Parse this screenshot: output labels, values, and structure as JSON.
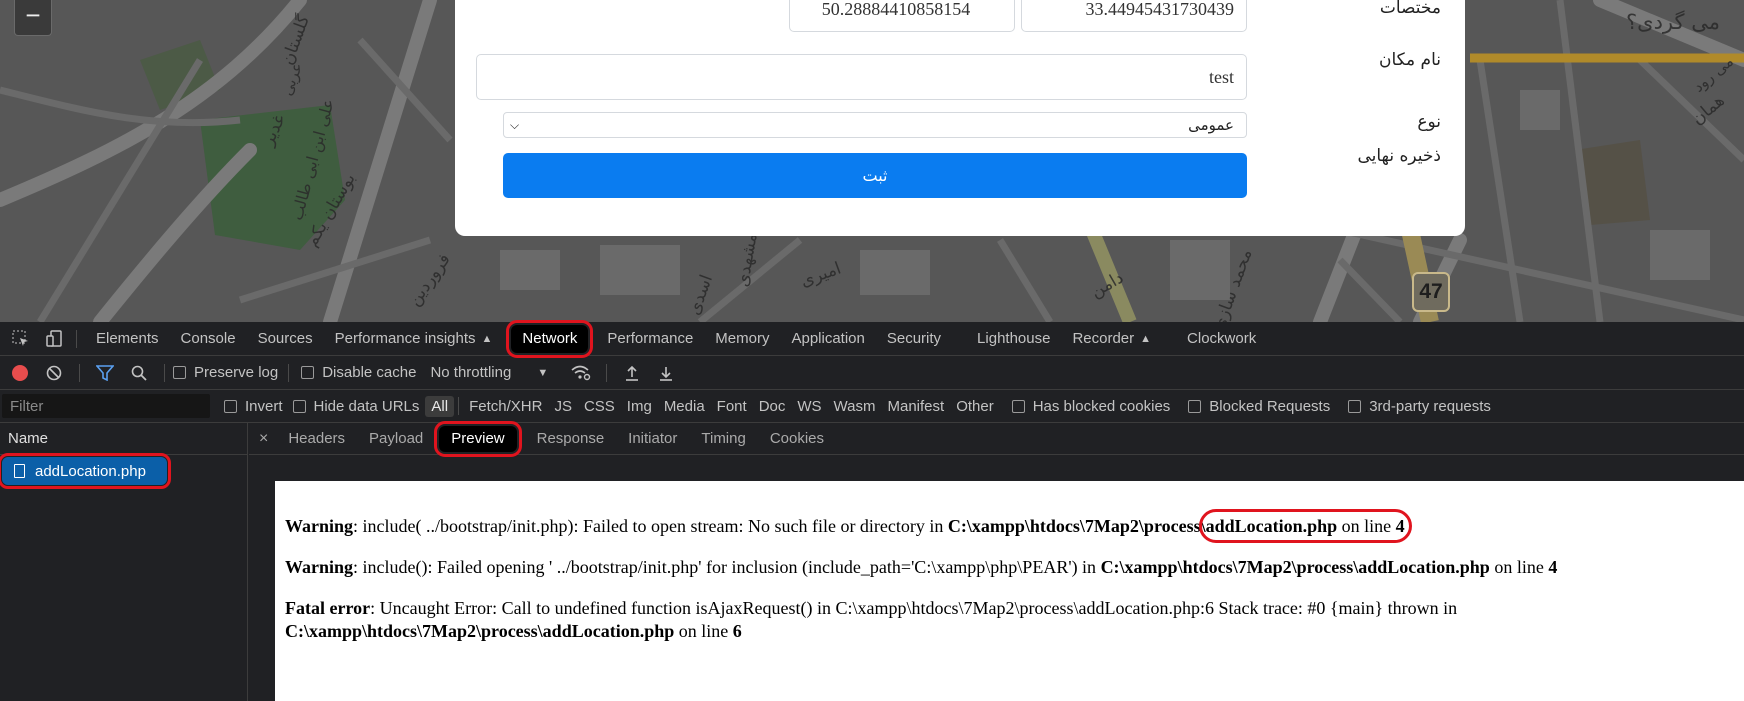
{
  "map": {
    "labels": [
      "می گردی؟",
      "بوستان یکم",
      "علی ابن ابی طالب",
      "غدیر",
      "فروردین",
      "امیری",
      "مشهدی",
      "اسدی",
      "محمد سازی",
      "گلستان",
      "عربی",
      "دامن",
      "همان",
      "می رود"
    ],
    "zoom_out_label": "−",
    "road_badge": "47"
  },
  "form": {
    "coords_label": "مختصات",
    "lat": "33.44945431730439",
    "lng": "50.28884410858154",
    "place_name_label": "نام مکان",
    "place_name_value": "test",
    "type_label": "نوع",
    "type_value": "عمومی",
    "save_label": "ذخیره نهایی",
    "submit_label": "ثبت"
  },
  "devtools": {
    "tabs": [
      "Elements",
      "Console",
      "Sources",
      "Performance insights",
      "Network",
      "Performance",
      "Memory",
      "Application",
      "Security",
      "Lighthouse",
      "Recorder",
      "Clockwork"
    ],
    "toolbar": {
      "preserve_log": "Preserve log",
      "disable_cache": "Disable cache",
      "throttling": "No throttling"
    },
    "filter": {
      "placeholder": "Filter",
      "invert": "Invert",
      "hide_data_urls": "Hide data URLs",
      "types": [
        "All",
        "Fetch/XHR",
        "JS",
        "CSS",
        "Img",
        "Media",
        "Font",
        "Doc",
        "WS",
        "Wasm",
        "Manifest",
        "Other"
      ],
      "has_blocked_cookies": "Has blocked cookies",
      "blocked_requests": "Blocked Requests",
      "third_party": "3rd-party requests"
    },
    "name_header": "Name",
    "request_name": "addLocation.php",
    "detail_tabs": [
      "Headers",
      "Payload",
      "Preview",
      "Response",
      "Initiator",
      "Timing",
      "Cookies"
    ],
    "close_label": "×",
    "preview": {
      "w1_label": "Warning",
      "w1_text": ": include( ../bootstrap/init.php): Failed to open stream: No such file or directory in ",
      "w1_path": "C:\\xampp\\htdocs\\7Map2\\process\\",
      "w1_file": "addLocation.php",
      "on_line": " on line ",
      "w1_line": "4",
      "w2_label": "Warning",
      "w2_text": ": include(): Failed opening ' ../bootstrap/init.php' for inclusion (include_path='C:\\xampp\\php\\PEAR') in ",
      "w2_path": "C:\\xampp\\htdocs\\7Map2\\process\\addLocation.php",
      "w2_line": "4",
      "f_label": "Fatal error",
      "f_text": ": Uncaught Error: Call to undefined function isAjaxRequest() in C:\\xampp\\htdocs\\7Map2\\process\\addLocation.php:6 Stack trace: #0 {main} thrown in",
      "f_path": "C:\\xampp\\htdocs\\7Map2\\process\\addLocation.php",
      "f_line": "6"
    }
  }
}
